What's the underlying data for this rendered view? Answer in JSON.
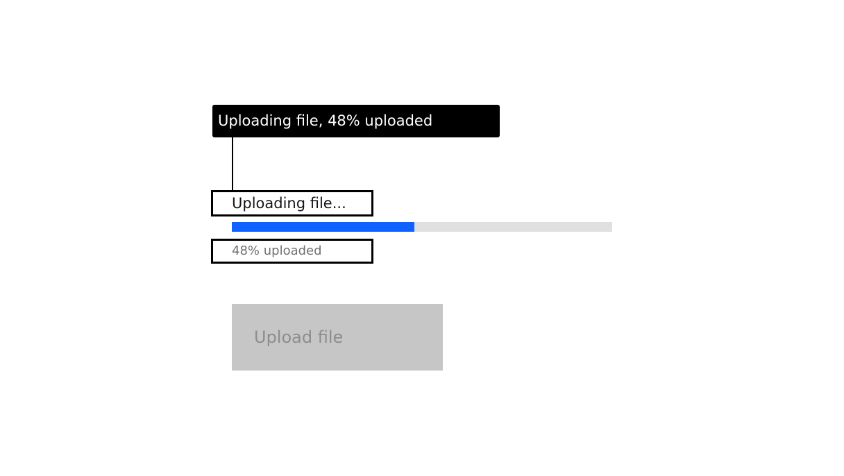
{
  "tooltip": {
    "text": "Uploading file, 48% uploaded"
  },
  "progress": {
    "label": "Uploading file...",
    "helper_text": "48% uploaded",
    "value_percent": 48,
    "fill_color": "#0f62fe",
    "track_color": "#e0e0e0"
  },
  "upload_button": {
    "label": "Upload file",
    "disabled": true
  }
}
